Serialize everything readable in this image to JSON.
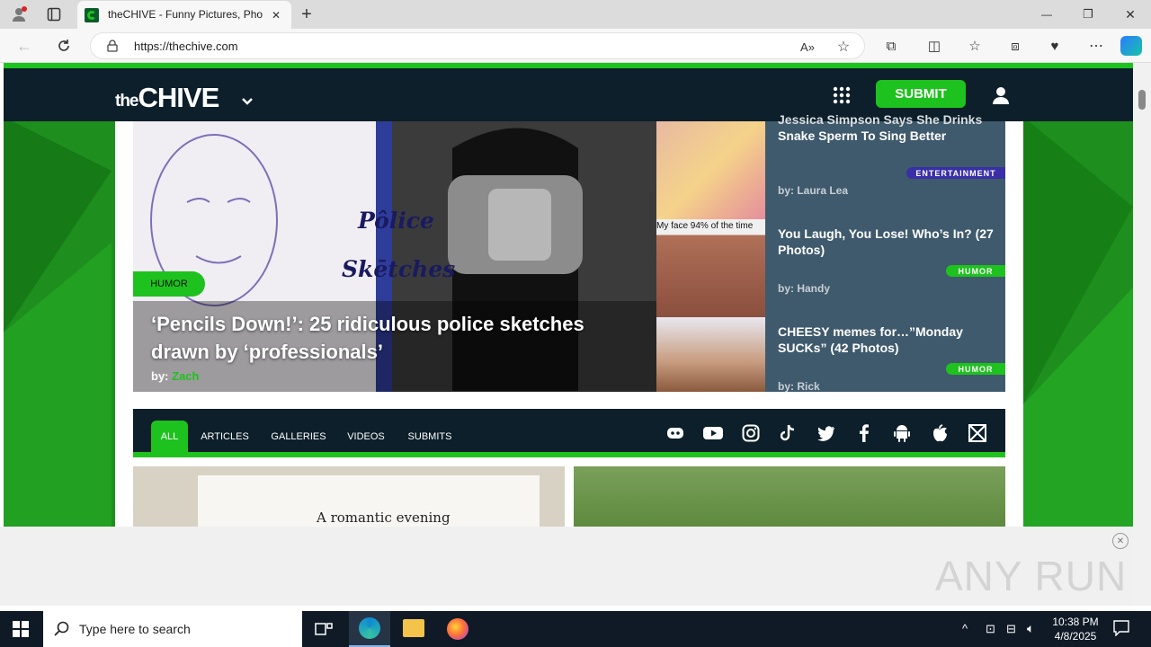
{
  "browser": {
    "tab_title": "theCHIVE - Funny Pictures, Phot",
    "url": "https://thechive.com",
    "new_tab": "+",
    "win_min": "—",
    "win_restore": "❐",
    "win_close": "✕"
  },
  "site": {
    "logo_prefix": "the",
    "logo_main": "CHIVE",
    "submit_label": "SUBMIT"
  },
  "hero": {
    "badge": "HUMOR",
    "title": "‘Pencils Down!’: 25 ridiculous police sketches drawn by ‘professionals’",
    "by_label": "by:",
    "author": "Zach",
    "sketch_text1": "Pôlice",
    "sketch_text2": "Skētches"
  },
  "side_articles": [
    {
      "title": "Snake Sperm To Sing Better",
      "title_partial": "Jessica Simpson Says She Drinks",
      "by_label": "by:",
      "author": "Laura Lea",
      "badge": "ENTERTAINMENT",
      "badge_color": "#3a2fa6"
    },
    {
      "title": "You Laugh, You Lose! Who’s In? (27 Photos)",
      "thumb_caption": "My face 94% of the time",
      "by_label": "by:",
      "author": "Handy",
      "badge": "HUMOR",
      "badge_color": "#1ec21e"
    },
    {
      "title": "CHEESY memes for…”Monday SUCKs” (42 Photos)",
      "by_label": "by:",
      "author": "Rick",
      "badge": "HUMOR",
      "badge_color": "#1ec21e"
    }
  ],
  "categories": [
    "ALL",
    "ARTICLES",
    "GALLERIES",
    "VIDEOS",
    "SUBMITS"
  ],
  "social_icons": [
    "discord-icon",
    "youtube-icon",
    "instagram-icon",
    "tiktok-icon",
    "twitter-icon",
    "facebook-icon",
    "android-icon",
    "apple-icon",
    "mail-icon"
  ],
  "card_text": "A romantic evening",
  "ad_watermark": "ANY RUN",
  "taskbar": {
    "search_placeholder": "Type here to search",
    "time": "10:38 PM",
    "date": "4/8/2025"
  },
  "colors": {
    "accent": "#1ec21e",
    "header": "#0c1f2a"
  }
}
